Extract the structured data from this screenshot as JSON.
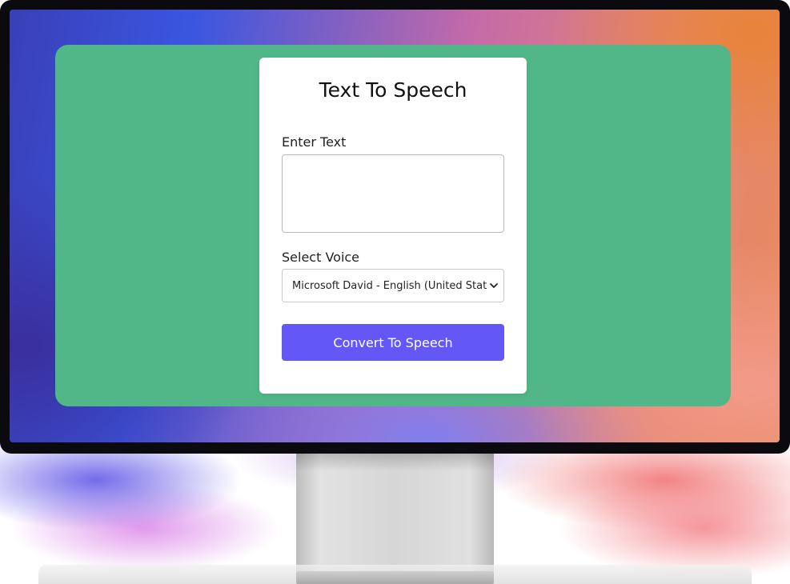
{
  "app": {
    "title": "Text To Speech",
    "text_label": "Enter Text",
    "text_value": "",
    "voice_label": "Select Voice",
    "voice_selected": "Microsoft David - English (United States)",
    "convert_button_label": "Convert To Speech"
  },
  "colors": {
    "panel_background": "#52b788",
    "card_background": "#ffffff",
    "button_background": "#6358f5",
    "button_text": "#ffffff"
  },
  "icons": {
    "select_chevron": "chevron-down-icon"
  }
}
